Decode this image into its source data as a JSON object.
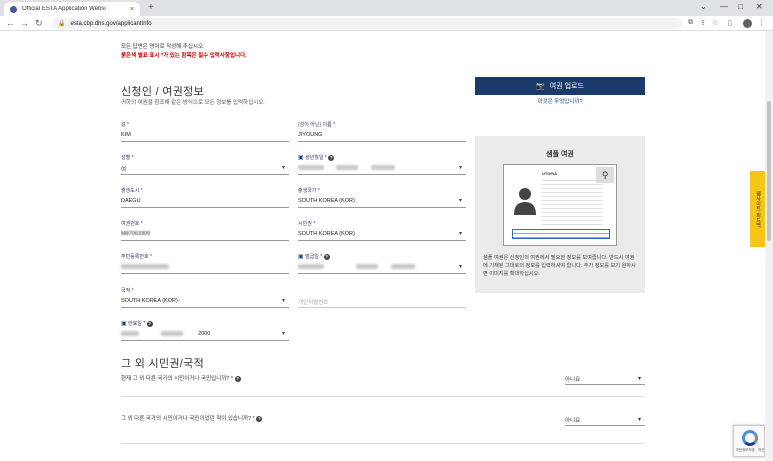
{
  "browser": {
    "tab_title": "Official ESTA Application Websi",
    "tab_close": "×",
    "new_tab": "+",
    "url": "esta.cbp.dhs.gov/applicantInfo"
  },
  "notes": {
    "line1": "모든 답변은 영어로 작성해 주십시오.",
    "line2": "붉은색 별표 표시 *가 있는 항목은 필수 입력사항입니다."
  },
  "section1": {
    "title": "신청인 / 여권정보",
    "subtitle": "귀하의 여권을 참조해 같은 방식으로 모든 정보를 입력하십시오."
  },
  "fields": {
    "surname": {
      "label": "성 *",
      "value": "KIM"
    },
    "given": {
      "label": "(성이 아닌) 이름 *",
      "value": "JIYOUNG"
    },
    "gender": {
      "label": "성별 *",
      "value": "여"
    },
    "dob": {
      "label": "생년월일 *"
    },
    "birth_city": {
      "label": "출생도시 *",
      "value": "DAEGU"
    },
    "birth_country": {
      "label": "출생국가 *",
      "value": "SOUTH KOREA (KOR)"
    },
    "passport_no": {
      "label": "여권번호 *",
      "value": "M87063309"
    },
    "citizenship": {
      "label": "시민권 *",
      "value": "SOUTH KOREA (KOR)"
    },
    "national_id": {
      "label": "주민등록번호 *"
    },
    "issue_date": {
      "label": "발급일 *"
    },
    "issuing_country": {
      "label": "국적 *",
      "value": "SOUTH KOREA (KOR)"
    },
    "personal_id": {
      "placeholder": "개인식별번호"
    },
    "expiry_date": {
      "label": "만료일 *",
      "value_year": "2000"
    }
  },
  "upload": {
    "button": "여권 업로드",
    "help_link": "이것은 무엇입니까?"
  },
  "sample": {
    "title": "샘플 여권",
    "passport_heading": "UTOPIA",
    "description": "샘플 여권은 신청인의 여권에서 필요한 정보를 보여줍니다. 반드시 여권에 기재된 그대로의 정보를 입력하셔야 합니다. 추가 정보를 보기 원하시면 이미지를 확대하십시오."
  },
  "feedback": {
    "label": "웹사이트 피드백"
  },
  "section2": {
    "title": "그 외 시민권/국적",
    "q1": "현재 그 외 다른 국가의 시민이거나 국민입니까? *",
    "q1_value": "아니요",
    "q2": "그 외 다른 국가의 시민이거나 국민이었던 적이 있습니까? *",
    "q2_value": "아니요"
  },
  "captcha": {
    "text": "개인정보보호 - 약관"
  }
}
